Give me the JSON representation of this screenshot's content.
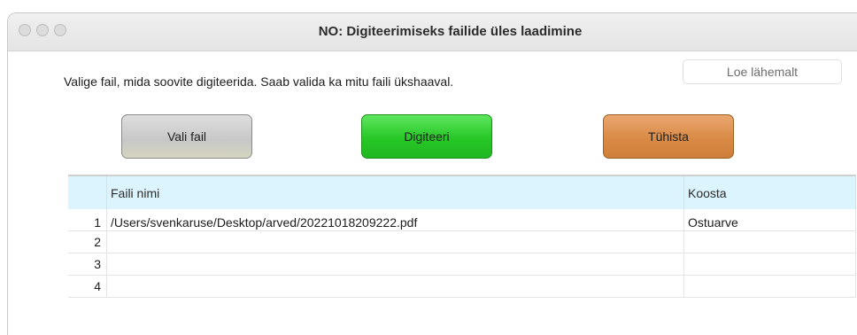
{
  "window": {
    "title": "NO: Digiteerimiseks failide üles laadimine"
  },
  "instruction": "Valige fail, mida soovite digiteerida. Saab valida ka mitu faili ükshaaval.",
  "more_button": "Loe lähemalt",
  "buttons": {
    "choose_file": "Vali fail",
    "digitize": "Digiteeri",
    "cancel": "Tühista"
  },
  "colors": {
    "choose_file": "#d0d0d0",
    "digitize": "#2ecb2e",
    "cancel": "#dc8c47",
    "table_header": "#dcf4fd"
  },
  "table": {
    "columns": [
      "",
      "Faili nimi",
      "Koosta"
    ],
    "rows": [
      {
        "num": "1",
        "file": "/Users/svenkaruse/Desktop/arved/20221018209222.pdf",
        "kind": "Ostuarve"
      },
      {
        "num": "2",
        "file": "",
        "kind": ""
      },
      {
        "num": "3",
        "file": "",
        "kind": ""
      },
      {
        "num": "4",
        "file": "",
        "kind": ""
      }
    ]
  }
}
